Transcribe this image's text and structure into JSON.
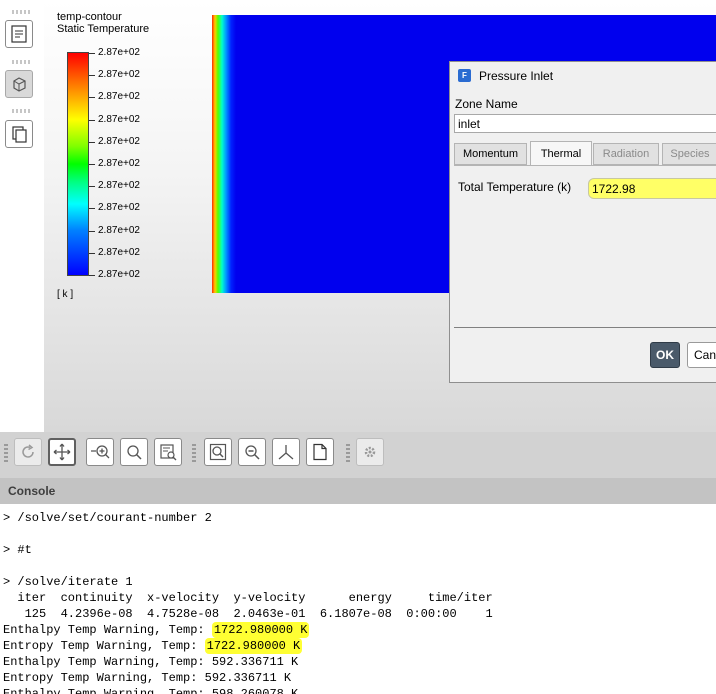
{
  "graphics": {
    "contour_name": "temp-contour",
    "contour_title": "Static Temperature",
    "colorbar_labels": [
      "2.87e+02",
      "2.87e+02",
      "2.87e+02",
      "2.87e+02",
      "2.87e+02",
      "2.87e+02",
      "2.87e+02",
      "2.87e+02",
      "2.87e+02",
      "2.87e+02",
      "2.87e+02"
    ],
    "unit": "[ k ]"
  },
  "dialog": {
    "title": "Pressure Inlet",
    "icon": "fluent-app-icon",
    "zone_name_label": "Zone Name",
    "zone_name_value": "inlet",
    "tabs": [
      "Momentum",
      "Thermal",
      "Radiation",
      "Species"
    ],
    "active_tab": "Thermal",
    "total_temperature_label": "Total Temperature (k)",
    "total_temperature_value": "1722.98",
    "ok_label": "OK",
    "cancel_label": "Can"
  },
  "console": {
    "title": "Console",
    "lines": [
      "> /solve/set/courant-number 2",
      "> #t",
      "> /solve/iterate 1",
      "  iter  continuity  x-velocity  y-velocity      energy     time/iter",
      "   125  4.2396e-08  4.7528e-08  2.0463e-01  6.1807e-08  0:00:00    1",
      "Enthalpy Temp Warning, Temp: ",
      "1722.980000 K",
      "Entropy Temp Warning, Temp: ",
      "1722.980000 K",
      "Enthalpy Temp Warning, Temp: 592.336711 K",
      "Entropy Temp Warning, Temp: 592.336711 K",
      "Enthalpy Temp Warning, Temp: 598.260078 K"
    ]
  },
  "colors": {
    "highlight": "#ffff33",
    "ok_button": "#4a5a6a",
    "console_header": "#c3c3c3"
  }
}
